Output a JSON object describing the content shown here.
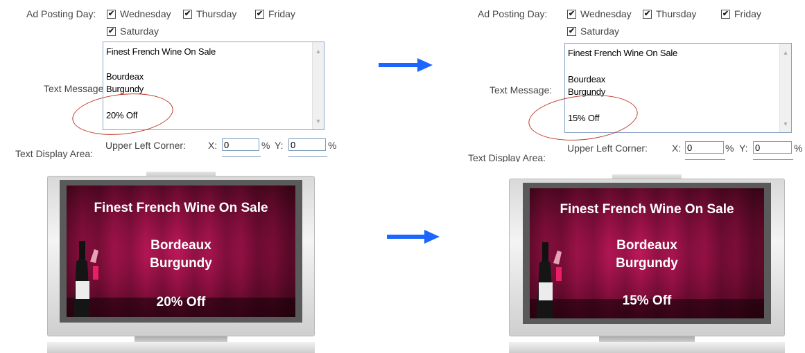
{
  "left": {
    "ad_posting_label": "Ad Posting Day:",
    "days": [
      {
        "label": "Wednesday",
        "checked": true
      },
      {
        "label": "Thursday",
        "checked": true
      },
      {
        "label": "Friday",
        "checked": true
      },
      {
        "label": "Saturday",
        "checked": true
      }
    ],
    "text_message_label": "Text Message:",
    "message_lines": [
      "Finest French Wine On Sale",
      "",
      "Bourdeax",
      "Burgundy",
      "",
      "20% Off"
    ],
    "text_display_label": "Text Display Area:",
    "upper_left_label": "Upper Left Corner:",
    "x_label": "X:",
    "x_value": "0",
    "pct": "%",
    "y_label": "Y:",
    "y_value": "0",
    "screen": {
      "title": "Finest French Wine On Sale",
      "line1": "Bordeaux",
      "line2": "Burgundy",
      "offer": "20% Off"
    }
  },
  "right": {
    "ad_posting_label": "Ad Posting Day:",
    "days": [
      {
        "label": "Wednesday",
        "checked": true
      },
      {
        "label": "Thursday",
        "checked": true
      },
      {
        "label": "Friday",
        "checked": true
      },
      {
        "label": "Saturday",
        "checked": true
      }
    ],
    "text_message_label": "Text Message:",
    "message_lines": [
      "Finest French Wine On Sale",
      "",
      "Bourdeax",
      "Burgundy",
      "",
      "15% Off"
    ],
    "text_display_label": "Text Display Area:",
    "upper_left_label": "Upper Left Corner:",
    "x_label": "X:",
    "x_value": "0",
    "pct": "%",
    "y_label": "Y:",
    "y_value": "0",
    "screen": {
      "title": "Finest French Wine On Sale",
      "line1": "Bordeaux",
      "line2": "Burgundy",
      "offer": "15% Off"
    }
  },
  "colors": {
    "arrow": "#1a66ff",
    "highlight_circle": "#c0392b",
    "screen_primary": "#a8124d"
  },
  "icons": {
    "check": "✔",
    "scroll_up": "▲",
    "scroll_down": "▼"
  }
}
